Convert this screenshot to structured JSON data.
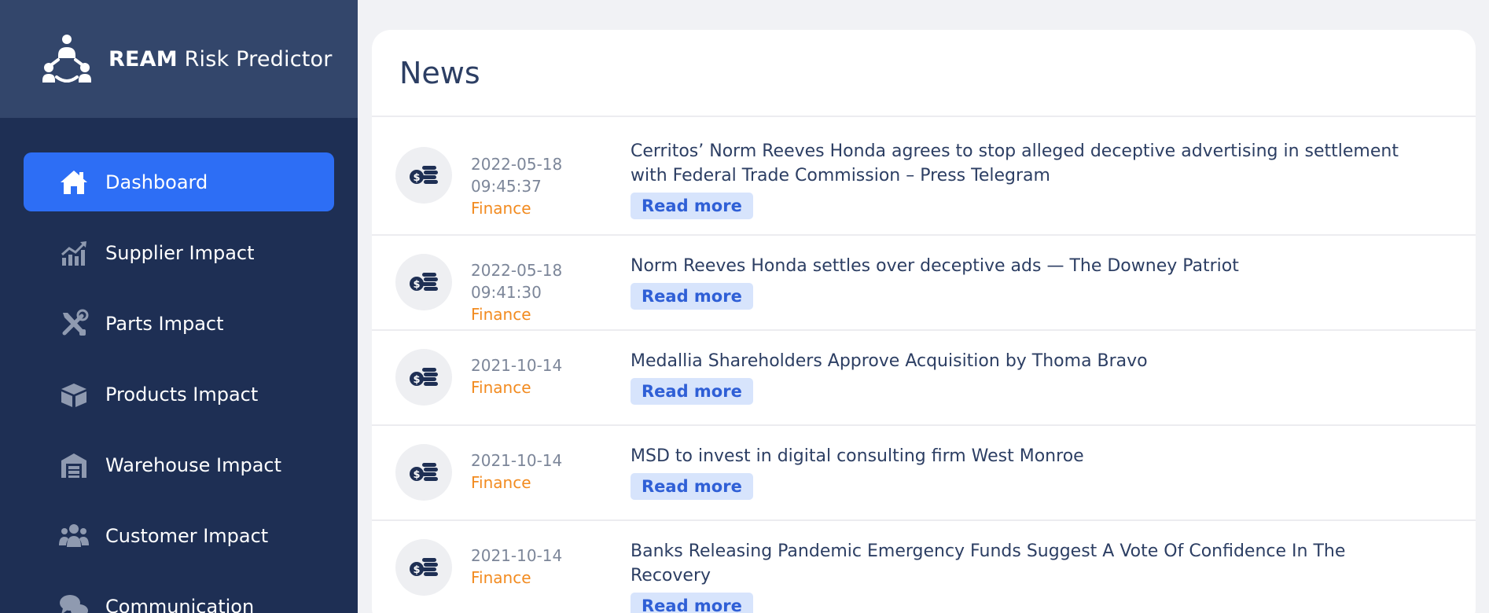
{
  "brand": {
    "bold": "REAM",
    "rest": " Risk Predictor"
  },
  "sidebar": {
    "items": [
      {
        "label": "Dashboard",
        "icon": "home-icon",
        "active": true
      },
      {
        "label": "Supplier Impact",
        "icon": "chart-line-icon"
      },
      {
        "label": "Parts Impact",
        "icon": "tools-icon"
      },
      {
        "label": "Products Impact",
        "icon": "box-icon"
      },
      {
        "label": "Warehouse Impact",
        "icon": "warehouse-icon"
      },
      {
        "label": "Customer Impact",
        "icon": "users-icon"
      },
      {
        "label": "Communication",
        "icon": "comments-icon"
      }
    ]
  },
  "news": {
    "title": "News",
    "read_more_label": "Read more",
    "items": [
      {
        "date": "2022-05-18 09:45:37",
        "category": "Finance",
        "title": "Cerritos’ Norm Reeves Honda agrees to stop alleged deceptive advertising in settlement with Federal Trade Commission – Press Telegram"
      },
      {
        "date": "2022-05-18 09:41:30",
        "category": "Finance",
        "title": "Norm Reeves Honda settles over deceptive ads — The Downey Patriot"
      },
      {
        "date": "2021-10-14",
        "category": "Finance",
        "title": "Medallia Shareholders Approve Acquisition by Thoma Bravo"
      },
      {
        "date": "2021-10-14",
        "category": "Finance",
        "title": "MSD to invest in digital consulting firm West Monroe"
      },
      {
        "date": "2021-10-14",
        "category": "Finance",
        "title": "Banks Releasing Pandemic Emergency Funds Suggest A Vote Of Confidence In The Recovery"
      }
    ]
  },
  "colors": {
    "sidebar_bg": "#1e2f54",
    "brand_bg": "#33466b",
    "active_item": "#2d6ef5",
    "category": "#f28b20",
    "read_more_text": "#2f5fd6",
    "read_more_bg": "#d7e4fc"
  }
}
